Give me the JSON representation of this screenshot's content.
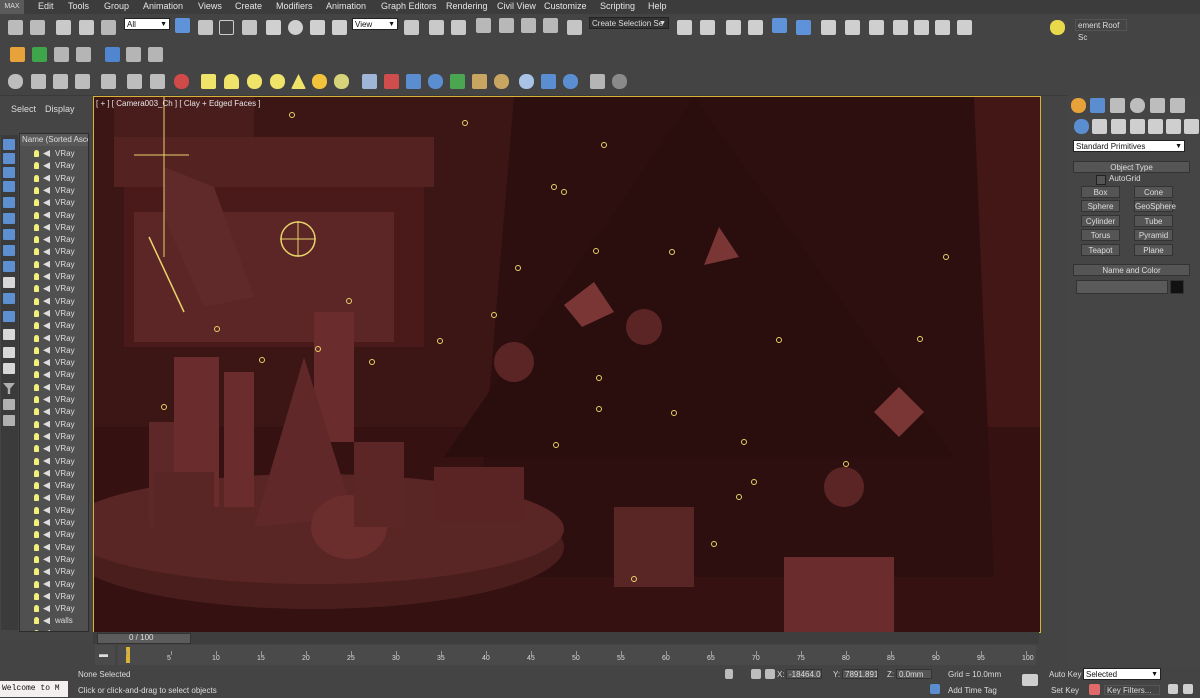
{
  "app": {
    "logo": "MAX"
  },
  "menu": [
    "Edit",
    "Tools",
    "Group",
    "Animation",
    "Views",
    "Create",
    "Modifiers",
    "Animation",
    "Graph Editors",
    "Rendering",
    "Civil View",
    "Customize",
    "Scripting",
    "Help"
  ],
  "toolbar": {
    "filter_value": "All",
    "view_value": "View",
    "selection_set_value": "Create Selection Se",
    "named_scene_value": "ement Roof Sc"
  },
  "left_panel": {
    "tabs": [
      "Select",
      "Display"
    ],
    "scene_explorer_header": "Name (Sorted Ascer",
    "rows": [
      "VRay",
      "VRay",
      "VRay",
      "VRay",
      "VRay",
      "VRay",
      "VRay",
      "VRay",
      "VRay",
      "VRay",
      "VRay",
      "VRay",
      "VRay",
      "VRay",
      "VRay",
      "VRay",
      "VRay",
      "VRay",
      "VRay",
      "VRay",
      "VRay",
      "VRay",
      "VRay",
      "VRay",
      "VRay",
      "VRay",
      "VRay",
      "VRay",
      "VRay",
      "VRay",
      "VRay",
      "VRay",
      "VRay",
      "VRay",
      "VRay",
      "VRay",
      "VRay",
      "VRay",
      "walls",
      "xmas"
    ]
  },
  "viewport": {
    "label": "[ + ] [ Camera003_Ch ] [ Clay + Edged Faces ]"
  },
  "command_panel": {
    "category": "Standard Primitives",
    "object_type_title": "Object Type",
    "autogrid_label": "AutoGrid",
    "buttons": [
      "Box",
      "Cone",
      "Sphere",
      "GeoSphere",
      "Cylinder",
      "Tube",
      "Torus",
      "Pyramid",
      "Teapot",
      "Plane"
    ],
    "name_color_title": "Name and Color",
    "object_color": "#111111"
  },
  "timeline": {
    "slider_text": "0 / 100",
    "ticks": [
      "0",
      "5",
      "10",
      "15",
      "20",
      "25",
      "30",
      "35",
      "40",
      "45",
      "50",
      "55",
      "60",
      "65",
      "70",
      "75",
      "80",
      "85",
      "90",
      "95",
      "100"
    ]
  },
  "status": {
    "listener": "Welcome to M",
    "selection": "None Selected",
    "prompt": "Click or click-and-drag to select objects",
    "x_label": "X:",
    "x_value": "-18464.00",
    "y_label": "Y:",
    "y_value": "7891.891",
    "z_label": "Z:",
    "z_value": "0.0mm",
    "grid": "Grid = 10.0mm",
    "add_time_tag": "Add Time Tag",
    "auto_key": "Auto Key",
    "auto_key_value": "Selected",
    "set_key": "Set Key",
    "key_filters": "Key Filters..."
  },
  "colors": {
    "accent": "#d8b33a",
    "viewport_bg": "#3a1414",
    "bulb": "#f1ef7a",
    "icon_blue": "#5d8fd1"
  }
}
